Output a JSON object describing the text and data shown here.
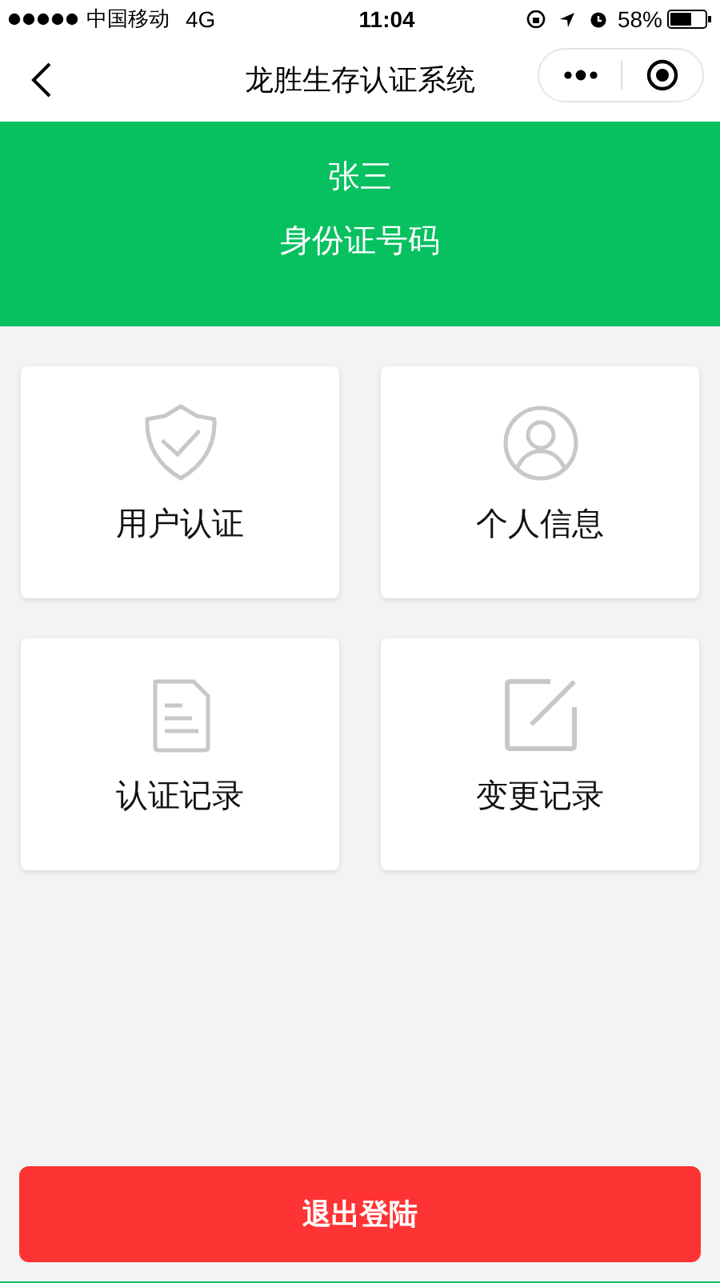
{
  "status_bar": {
    "carrier": "中国移动",
    "network": "4G",
    "time": "11:04",
    "battery": "58%"
  },
  "nav": {
    "title": "龙胜生存认证系统"
  },
  "header": {
    "name": "张三",
    "id_label": "身份证号码"
  },
  "cards": [
    {
      "kind": "shield",
      "label": "用户认证"
    },
    {
      "kind": "user",
      "label": "个人信息"
    },
    {
      "kind": "document",
      "label": "认证记录"
    },
    {
      "kind": "edit",
      "label": "变更记录"
    }
  ],
  "logout_button": "退出登陆"
}
